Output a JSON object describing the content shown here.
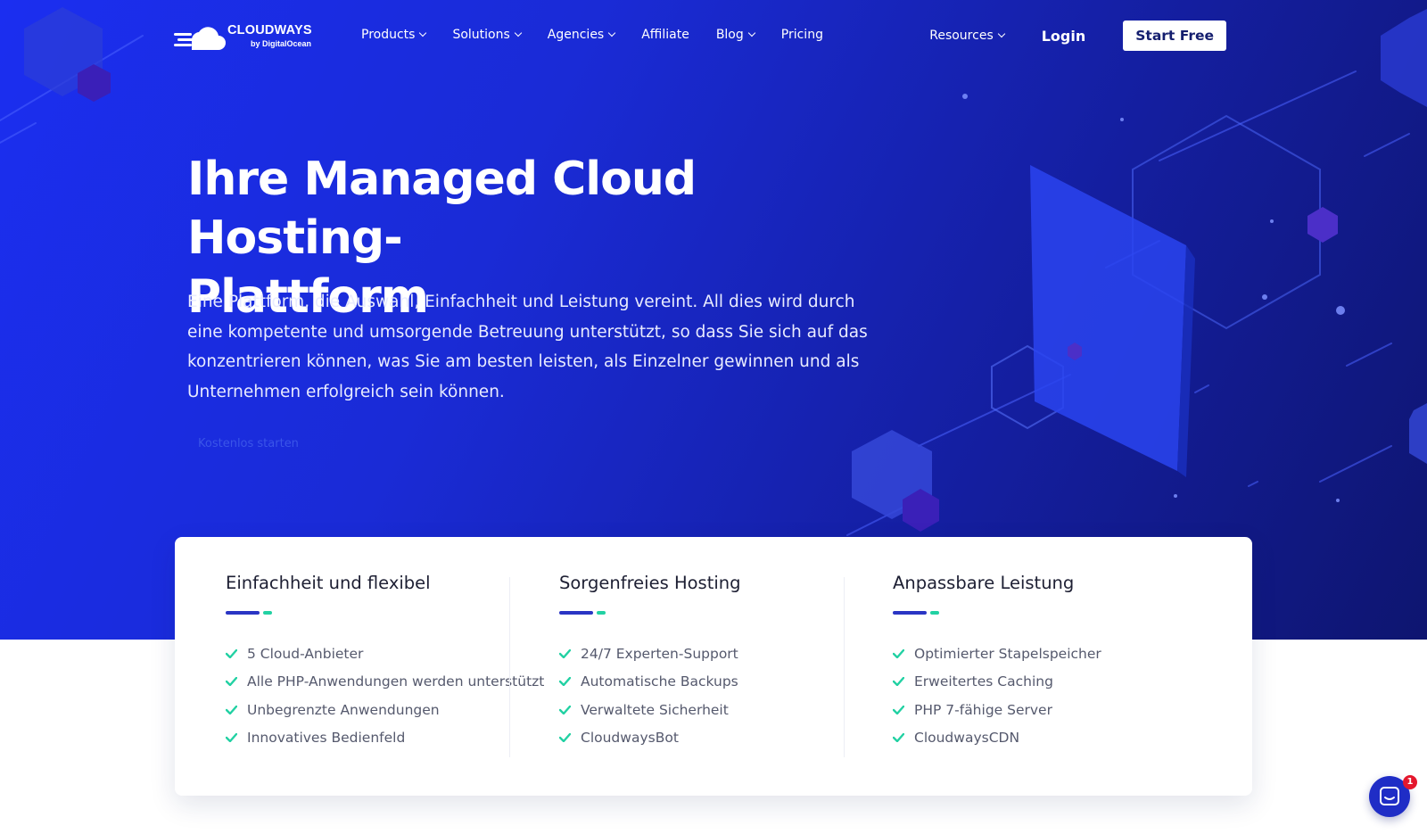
{
  "brand": {
    "name": "CLOUDWAYS",
    "byline": "by DigitalOcean",
    "colors": {
      "hero_start": "#1b2ef0",
      "hero_end": "#0e1570",
      "accent_blue": "#2a35c4",
      "accent_green": "#22d1a3",
      "chat_badge": "#e4172d"
    }
  },
  "nav": {
    "items": [
      {
        "label": "Products",
        "dropdown": true
      },
      {
        "label": "Solutions",
        "dropdown": true
      },
      {
        "label": "Agencies",
        "dropdown": true
      },
      {
        "label": "Affiliate",
        "dropdown": false
      },
      {
        "label": "Blog",
        "dropdown": true
      },
      {
        "label": "Pricing",
        "dropdown": false
      }
    ],
    "resources_label": "Resources",
    "login_label": "Login",
    "start_free_label": "Start Free"
  },
  "hero": {
    "headline_line1": "Ihre Managed Cloud Hosting-",
    "headline_line2": "Plattform",
    "subtext": "Eine Plattform, die Auswahl, Einfachheit und Leistung vereint. All dies wird durch eine kompetente und umsorgende Betreuung unterstützt, so dass Sie sich auf das konzentrieren können, was Sie am besten leisten, als Einzelner gewinnen und als Unternehmen erfolgreich sein können.",
    "cta_label": "Kostenlos starten"
  },
  "features": [
    {
      "title": "Einfachheit und flexibel",
      "items": [
        "5 Cloud-Anbieter",
        "Alle PHP-Anwendungen werden unterstützt",
        "Unbegrenzte Anwendungen",
        "Innovatives Bedienfeld"
      ]
    },
    {
      "title": "Sorgenfreies Hosting",
      "items": [
        "24/7 Experten-Support",
        "Automatische Backups",
        "Verwaltete Sicherheit",
        "CloudwaysBot"
      ]
    },
    {
      "title": "Anpassbare Leistung",
      "items": [
        "Optimierter Stapelspeicher",
        "Erweitertes Caching",
        "PHP 7-fähige Server",
        "CloudwaysCDN"
      ]
    }
  ],
  "chat": {
    "icon": "chat-icon",
    "badge_count": "1"
  }
}
